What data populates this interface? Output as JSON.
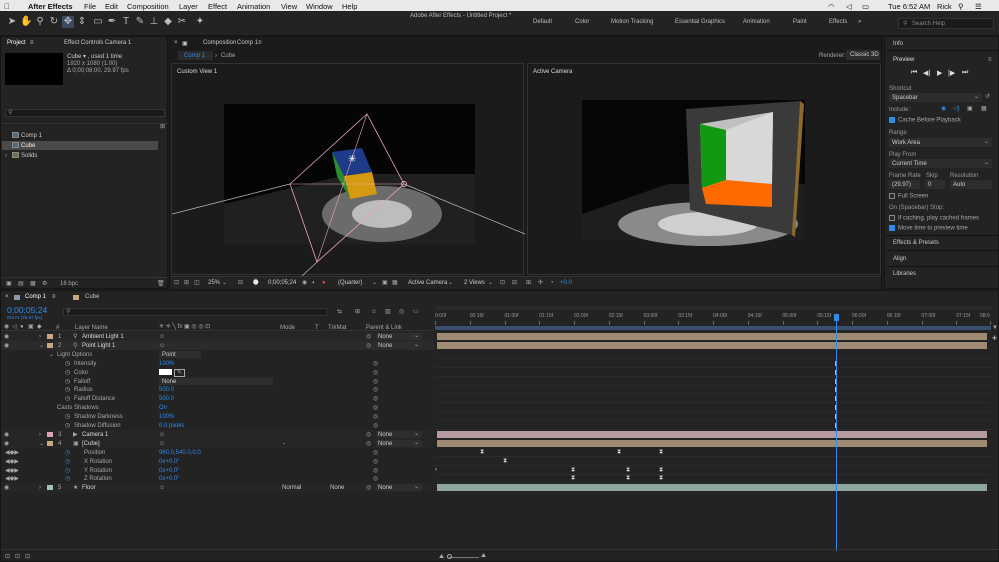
{
  "menubar": {
    "app": "After Effects",
    "items": [
      "File",
      "Edit",
      "Composition",
      "Layer",
      "Effect",
      "Animation",
      "View",
      "Window",
      "Help"
    ],
    "window_title": "Adobe After Effects - Untitled Project *",
    "clock": "Tue 6:52 AM",
    "user": "Rick",
    "search": "Search Help"
  },
  "workspaces": [
    "Default",
    "Color",
    "Motion Tracking",
    "Essential Graphics",
    "Animation",
    "Paint",
    "Effects"
  ],
  "project": {
    "tab": "Project",
    "tab2": "Effect Controls Camera 1",
    "item_name": "Cube ▾ , used 1 time",
    "item_size": "1920 x 1080 (1.00)",
    "item_duration": "Δ 0;00;08;00, 29.97 fps",
    "items": [
      {
        "name": "Comp 1",
        "type": "comp"
      },
      {
        "name": "Cube",
        "type": "comp"
      },
      {
        "name": "Solids",
        "type": "folder"
      }
    ],
    "bpc": "16 bpc"
  },
  "comp": {
    "tab": "Composition",
    "tab_name": "Comp 1",
    "breadcrumb": [
      "Comp 1",
      "Cube"
    ],
    "renderer_label": "Renderer:",
    "renderer": "Classic 3D",
    "view_left": "Custom View 1",
    "view_right": "Active Camera",
    "zoom": "25%",
    "time": "0;00;05;24",
    "resolution": "(Quarter)",
    "camera": "Active Camera",
    "views": "2 Views",
    "exposure": "+0.0"
  },
  "right_panel": {
    "info": "Info",
    "preview": "Preview",
    "shortcut_label": "Shortcut",
    "shortcut": "Spacebar",
    "include": "Include:",
    "cache_before": "Cache Before Playback",
    "range_label": "Range",
    "range": "Work Area",
    "play_from_label": "Play From",
    "play_from": "Current Time",
    "frame_rate_label": "Frame Rate",
    "skip_label": "Skip",
    "resolution_label": "Resolution",
    "frame_rate": "(29.97)",
    "skip": "0",
    "resolution": "Auto",
    "full_screen": "Full Screen",
    "stop_label": "On (Spacebar) Stop:",
    "if_caching": "If caching, play cached frames",
    "move_time": "Move time to preview time",
    "effects_presets": "Effects & Presets",
    "align": "Align",
    "libraries": "Libraries"
  },
  "timeline": {
    "tab": "Comp 1",
    "tab2": "Cube",
    "time": "0;00;05;24",
    "fps": "00174 (29.97 fps)",
    "col_layer_name": "Layer Name",
    "col_mode": "Mode",
    "col_t": "T",
    "col_trkmat": "TrkMat",
    "col_parent": "Parent & Link",
    "col_num": "#",
    "ruler": [
      "0:00f",
      "00:15f",
      "01:00f",
      "01:15f",
      "02:00f",
      "02:15f",
      "03:00f",
      "03:15f",
      "04:00f",
      "04:15f",
      "05:00f",
      "05:15f",
      "06:00f",
      "06:15f",
      "07:00f",
      "07:15f",
      "08:0"
    ],
    "rows": [
      {
        "kind": "layer",
        "num": "1",
        "name": "Ambient Light 1",
        "parent": "None",
        "color": "#c8a882",
        "bar": "#9f8a73"
      },
      {
        "kind": "layer",
        "num": "2",
        "name": "Point Light 1",
        "parent": "None",
        "color": "#c8a882",
        "bar": "#9f8a73"
      },
      {
        "kind": "group",
        "name": "Light Options",
        "value": "Point"
      },
      {
        "kind": "prop",
        "name": "Intensity",
        "value": "100%"
      },
      {
        "kind": "prop",
        "name": "Color",
        "value": ""
      },
      {
        "kind": "prop",
        "name": "Falloff",
        "value": "None"
      },
      {
        "kind": "prop",
        "name": "Radius",
        "value": "500.0"
      },
      {
        "kind": "prop",
        "name": "Falloff Distance",
        "value": "500.0"
      },
      {
        "kind": "plain",
        "name": "Casts Shadows",
        "value": "On"
      },
      {
        "kind": "prop",
        "name": "Shadow Darkness",
        "value": "100%"
      },
      {
        "kind": "prop",
        "name": "Shadow Diffusion",
        "value": "0.0 pixels"
      },
      {
        "kind": "layer",
        "num": "3",
        "name": "Camera 1",
        "parent": "None",
        "color": "#d7a6b0",
        "bar": "#b59aa0"
      },
      {
        "kind": "layer",
        "num": "4",
        "name": "[Cube]",
        "parent": "None",
        "color": "#c8a882",
        "bar": "#9f8a73",
        "mode": "-"
      },
      {
        "kind": "kprop",
        "name": "Position",
        "value": "960.0,540.0,0.0"
      },
      {
        "kind": "kprop",
        "name": "X Rotation",
        "value": "0x+0.0°"
      },
      {
        "kind": "kprop",
        "name": "Y Rotation",
        "value": "0x+0.0°"
      },
      {
        "kind": "kprop",
        "name": "Z Rotation",
        "value": "0x+0.0°"
      },
      {
        "kind": "layer",
        "num": "5",
        "name": "Floor",
        "parent": "None",
        "color": "#9fc4b5",
        "bar": "#8ea69b",
        "mode": "Normal",
        "trkmat": "None"
      }
    ]
  },
  "colors": {
    "accent": "#2d8ceb",
    "playhead": "#2d8ceb",
    "light_gizmo": "#e8a6b9"
  }
}
